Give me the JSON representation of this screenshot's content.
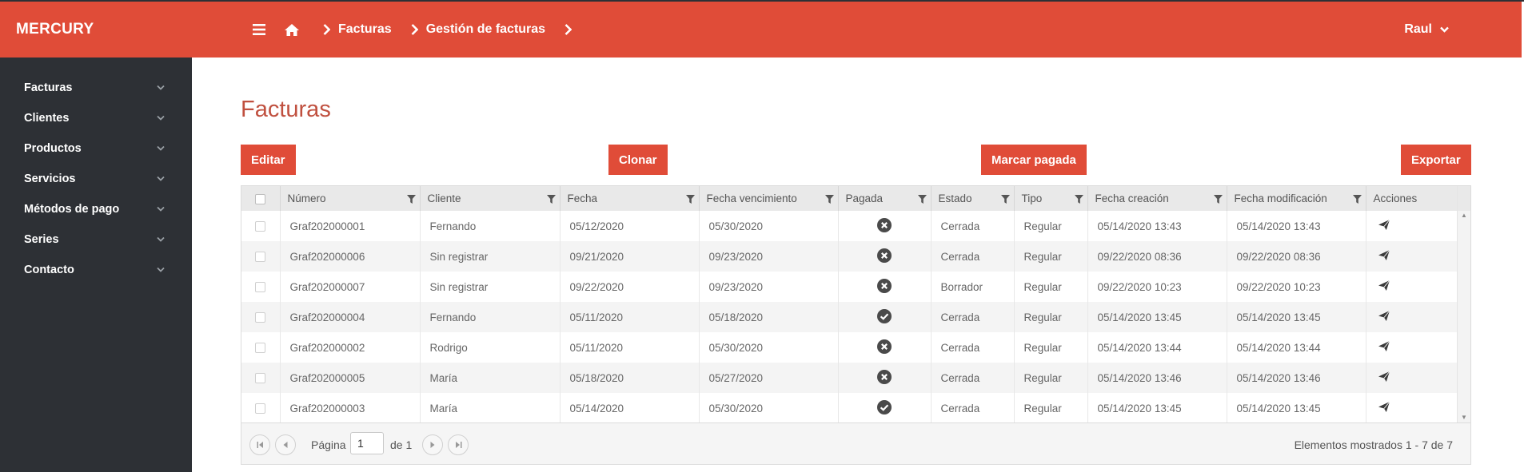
{
  "app": {
    "brand": "MERCURY",
    "user": "Raul"
  },
  "breadcrumb": {
    "items": [
      "Facturas",
      "Gestión de facturas"
    ]
  },
  "sidebar": {
    "items": [
      {
        "label": "Facturas"
      },
      {
        "label": "Clientes"
      },
      {
        "label": "Productos"
      },
      {
        "label": "Servicios"
      },
      {
        "label": "Métodos de pago"
      },
      {
        "label": "Series"
      },
      {
        "label": "Contacto"
      }
    ]
  },
  "page": {
    "title": "Facturas"
  },
  "toolbar": {
    "edit_label": "Editar",
    "clone_label": "Clonar",
    "mark_paid_label": "Marcar pagada",
    "export_label": "Exportar"
  },
  "table": {
    "columns": [
      "Número",
      "Cliente",
      "Fecha",
      "Fecha vencimiento",
      "Pagada",
      "Estado",
      "Tipo",
      "Fecha creación",
      "Fecha modificación",
      "Acciones"
    ],
    "rows": [
      {
        "numero": "Graf202000001",
        "cliente": "Fernando",
        "fecha": "05/12/2020",
        "vencimiento": "05/30/2020",
        "pagada": "no",
        "estado": "Cerrada",
        "tipo": "Regular",
        "creacion": "05/14/2020 13:43",
        "modificacion": "05/14/2020 13:43"
      },
      {
        "numero": "Graf202000006",
        "cliente": "Sin registrar",
        "fecha": "09/21/2020",
        "vencimiento": "09/23/2020",
        "pagada": "no",
        "estado": "Cerrada",
        "tipo": "Regular",
        "creacion": "09/22/2020 08:36",
        "modificacion": "09/22/2020 08:36"
      },
      {
        "numero": "Graf202000007",
        "cliente": "Sin registrar",
        "fecha": "09/22/2020",
        "vencimiento": "09/23/2020",
        "pagada": "no",
        "estado": "Borrador",
        "tipo": "Regular",
        "creacion": "09/22/2020 10:23",
        "modificacion": "09/22/2020 10:23"
      },
      {
        "numero": "Graf202000004",
        "cliente": "Fernando",
        "fecha": "05/11/2020",
        "vencimiento": "05/18/2020",
        "pagada": "yes",
        "estado": "Cerrada",
        "tipo": "Regular",
        "creacion": "05/14/2020 13:45",
        "modificacion": "05/14/2020 13:45"
      },
      {
        "numero": "Graf202000002",
        "cliente": "Rodrigo",
        "fecha": "05/11/2020",
        "vencimiento": "05/30/2020",
        "pagada": "no",
        "estado": "Cerrada",
        "tipo": "Regular",
        "creacion": "05/14/2020 13:44",
        "modificacion": "05/14/2020 13:44"
      },
      {
        "numero": "Graf202000005",
        "cliente": "María",
        "fecha": "05/18/2020",
        "vencimiento": "05/27/2020",
        "pagada": "no",
        "estado": "Cerrada",
        "tipo": "Regular",
        "creacion": "05/14/2020 13:46",
        "modificacion": "05/14/2020 13:46"
      },
      {
        "numero": "Graf202000003",
        "cliente": "María",
        "fecha": "05/14/2020",
        "vencimiento": "05/30/2020",
        "pagada": "yes",
        "estado": "Cerrada",
        "tipo": "Regular",
        "creacion": "05/14/2020 13:45",
        "modificacion": "05/14/2020 13:45"
      }
    ]
  },
  "pager": {
    "page_label": "Página",
    "current_page": "1",
    "of_label": "de 1",
    "info": "Elementos mostrados 1 - 7 de 7"
  },
  "icons": {
    "menu": "hamburger-icon",
    "home": "home-icon",
    "separator": "chevron-right-icon",
    "filter": "filter-icon",
    "paid": "check-circle-icon",
    "unpaid": "x-circle-icon",
    "action": "send-icon"
  },
  "colors": {
    "brand": "#e04c38",
    "sidebar": "#2d3035",
    "title": "#c0503f"
  }
}
